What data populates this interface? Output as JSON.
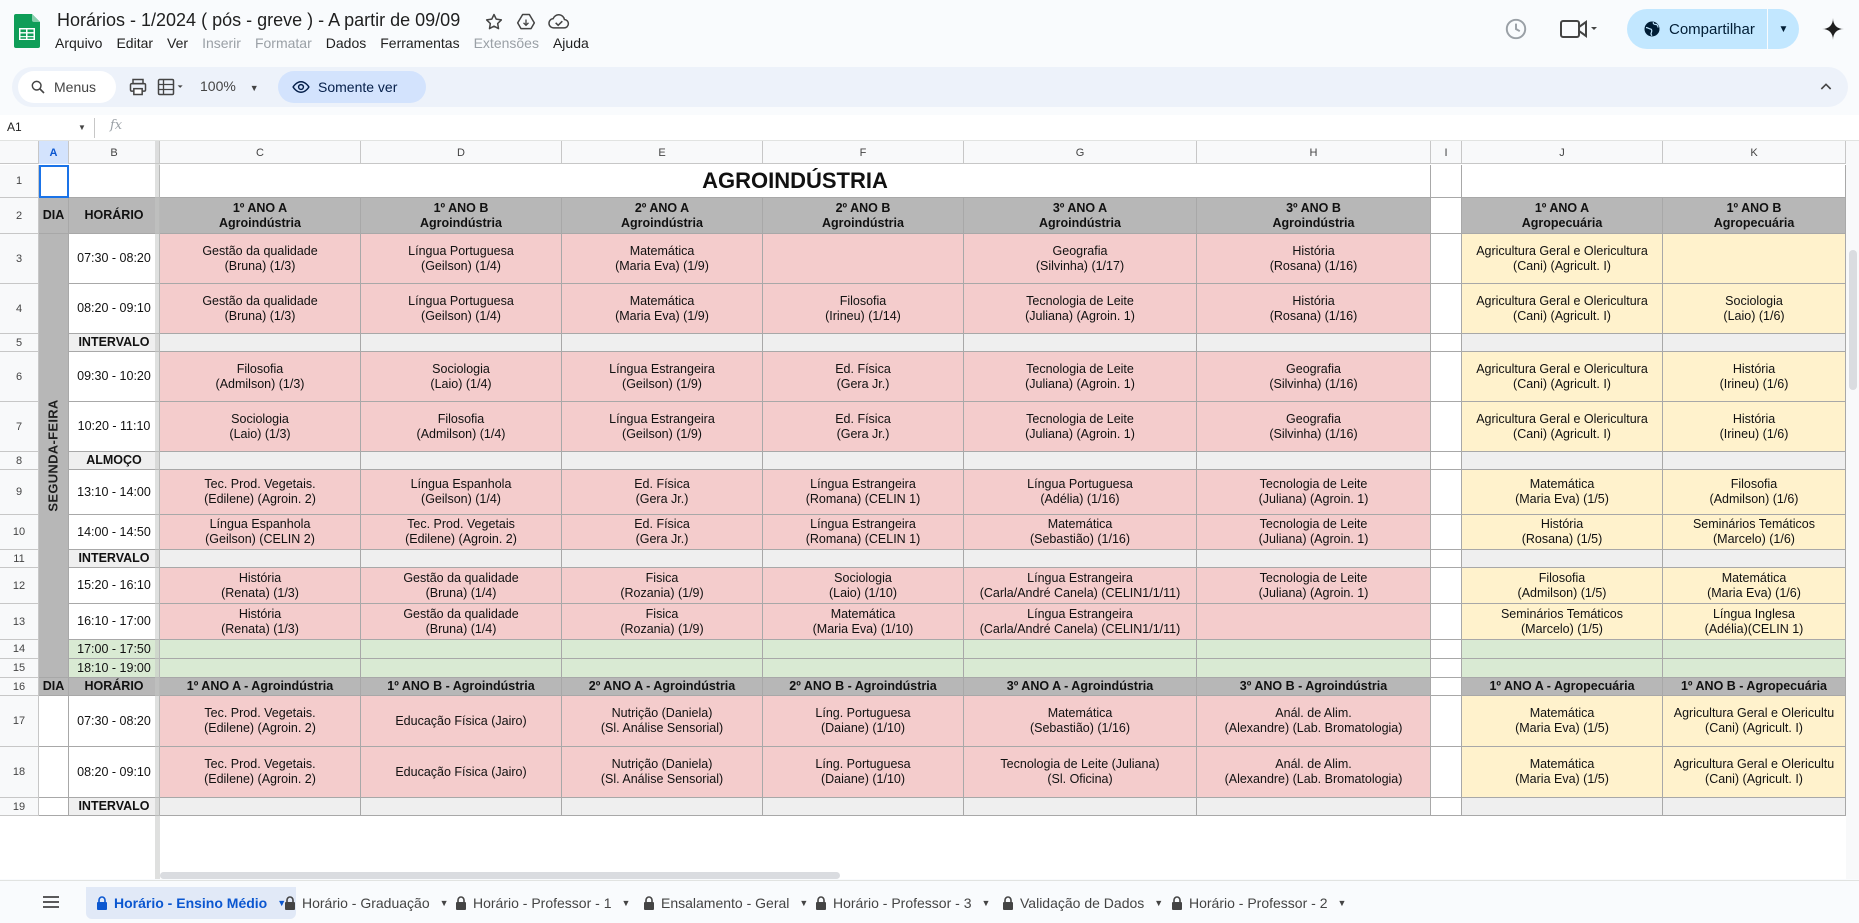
{
  "header": {
    "title": "Horários - 1/2024 ( pós - greve ) - A partir de 09/09",
    "menus": [
      {
        "label": "Arquivo",
        "disabled": false
      },
      {
        "label": "Editar",
        "disabled": false
      },
      {
        "label": "Ver",
        "disabled": false
      },
      {
        "label": "Inserir",
        "disabled": true
      },
      {
        "label": "Formatar",
        "disabled": true
      },
      {
        "label": "Dados",
        "disabled": false
      },
      {
        "label": "Ferramentas",
        "disabled": false
      },
      {
        "label": "Extensões",
        "disabled": true
      },
      {
        "label": "Ajuda",
        "disabled": false
      }
    ],
    "share_label": "Compartilhar"
  },
  "toolbar": {
    "search_placeholder": "Menus",
    "zoom": "100%",
    "view_only_label": "Somente ver"
  },
  "formula_bar": {
    "cell_ref": "A1",
    "fx": "fx"
  },
  "columns": [
    "A",
    "B",
    "C",
    "D",
    "E",
    "F",
    "G",
    "H",
    "I",
    "J",
    "K"
  ],
  "sheet": {
    "title": "AGROINDÚSTRIA",
    "header_row": {
      "dia": "DIA",
      "horario": "HORÁRIO",
      "classes": [
        [
          "1º ANO A",
          "Agroindústria"
        ],
        [
          "1º ANO B",
          "Agroindústria"
        ],
        [
          "2º ANO A",
          "Agroindústria"
        ],
        [
          "2º ANO B",
          "Agroindústria"
        ],
        [
          "3º ANO A",
          "Agroindústria"
        ],
        [
          "3º ANO B",
          "Agroindústria"
        ],
        [
          "1º ANO A",
          "Agropecuária"
        ],
        [
          "1º ANO B",
          "Agropecuária"
        ]
      ]
    },
    "day": "SEGUNDA-FEIRA",
    "rows": [
      {
        "n": "3",
        "time": "07:30 - 08:20",
        "kind": "class",
        "cells": [
          [
            "Gestão da qualidade",
            "(Bruna) (1/3)"
          ],
          [
            "Língua Portuguesa",
            "(Geilson) (1/4)"
          ],
          [
            "Matemática",
            "(Maria Eva) (1/9)"
          ],
          [],
          [
            "Geografia",
            "(Silvinha) (1/17)"
          ],
          [
            "História",
            "(Rosana) (1/16)"
          ],
          [
            "Agricultura Geral e Olericultura",
            "(Cani) (Agricult. I)"
          ],
          []
        ]
      },
      {
        "n": "4",
        "time": "08:20 - 09:10",
        "kind": "class",
        "cells": [
          [
            "Gestão da qualidade",
            "(Bruna) (1/3)"
          ],
          [
            "Língua Portuguesa",
            "(Geilson) (1/4)"
          ],
          [
            "Matemática",
            "(Maria Eva) (1/9)"
          ],
          [
            "Filosofia",
            "(Irineu) (1/14)"
          ],
          [
            "Tecnologia de Leite",
            "(Juliana) (Agroin. 1)"
          ],
          [
            "História",
            "(Rosana) (1/16)"
          ],
          [
            "Agricultura Geral e Olericultura",
            "(Cani) (Agricult. I)"
          ],
          [
            "Sociologia",
            "(Laio) (1/6)"
          ]
        ]
      },
      {
        "n": "5",
        "time": "INTERVALO",
        "kind": "break"
      },
      {
        "n": "6",
        "time": "09:30 - 10:20",
        "kind": "class",
        "cells": [
          [
            "Filosofia",
            "(Admilson) (1/3)"
          ],
          [
            "Sociologia",
            "(Laio) (1/4)"
          ],
          [
            "Língua Estrangeira",
            "(Geilson) (1/9)"
          ],
          [
            "Ed. Física",
            "(Gera Jr.)"
          ],
          [
            "Tecnologia de Leite",
            "(Juliana) (Agroin. 1)"
          ],
          [
            "Geografia",
            "(Silvinha) (1/16)"
          ],
          [
            "Agricultura Geral e Olericultura",
            "(Cani) (Agricult. I)"
          ],
          [
            "História",
            "(Irineu) (1/6)"
          ]
        ]
      },
      {
        "n": "7",
        "time": "10:20 - 11:10",
        "kind": "class",
        "cells": [
          [
            "Sociologia",
            "(Laio) (1/3)"
          ],
          [
            "Filosofia",
            "(Admilson) (1/4)"
          ],
          [
            "Língua Estrangeira",
            "(Geilson) (1/9)"
          ],
          [
            "Ed. Física",
            "(Gera Jr.)"
          ],
          [
            "Tecnologia de Leite",
            "(Juliana) (Agroin. 1)"
          ],
          [
            "Geografia",
            "(Silvinha) (1/16)"
          ],
          [
            "Agricultura Geral e Olericultura",
            "(Cani) (Agricult. I)"
          ],
          [
            "História",
            "(Irineu) (1/6)"
          ]
        ]
      },
      {
        "n": "8",
        "time": "ALMOÇO",
        "kind": "break"
      },
      {
        "n": "9",
        "time": "13:10 - 14:00",
        "kind": "class",
        "cells": [
          [
            "Tec. Prod. Vegetais.",
            "(Edilene) (Agroin. 2)"
          ],
          [
            "Língua Espanhola",
            "(Geilson) (1/4)"
          ],
          [
            "Ed. Física",
            "(Gera Jr.)"
          ],
          [
            "Língua Estrangeira",
            "(Romana) (CELIN 1)"
          ],
          [
            "Língua Portuguesa",
            "(Adélia) (1/16)"
          ],
          [
            "Tecnologia de Leite",
            "(Juliana) (Agroin. 1)"
          ],
          [
            "Matemática",
            "(Maria Eva) (1/5)"
          ],
          [
            "Filosofia",
            "(Admilson) (1/6)"
          ]
        ]
      },
      {
        "n": "10",
        "time": "14:00 - 14:50",
        "kind": "class",
        "cells": [
          [
            "Língua Espanhola",
            "(Geilson) (CELIN 2)"
          ],
          [
            "Tec. Prod. Vegetais",
            "(Edilene) (Agroin. 2)"
          ],
          [
            "Ed. Física",
            "(Gera Jr.)"
          ],
          [
            "Língua Estrangeira",
            "(Romana) (CELIN 1)"
          ],
          [
            "Matemática",
            "(Sebastião) (1/16)"
          ],
          [
            "Tecnologia de Leite",
            "(Juliana) (Agroin. 1)"
          ],
          [
            "História",
            "(Rosana) (1/5)"
          ],
          [
            "Seminários Temáticos",
            "(Marcelo) (1/6)"
          ]
        ]
      },
      {
        "n": "11",
        "time": "INTERVALO",
        "kind": "break"
      },
      {
        "n": "12",
        "time": "15:20 - 16:10",
        "kind": "class",
        "cells": [
          [
            "História",
            "(Renata) (1/3)"
          ],
          [
            "Gestão da qualidade",
            "(Bruna) (1/4)"
          ],
          [
            "Fisica",
            "(Rozania) (1/9)"
          ],
          [
            "Sociologia",
            "(Laio) (1/10)"
          ],
          [
            "Língua Estrangeira",
            "(Carla/André Canela) (CELIN1/1/11)"
          ],
          [
            "Tecnologia de Leite",
            "(Juliana) (Agroin. 1)"
          ],
          [
            "Filosofia",
            "(Admilson) (1/5)"
          ],
          [
            "Matemática",
            "(Maria Eva) (1/6)"
          ]
        ]
      },
      {
        "n": "13",
        "time": "16:10 - 17:00",
        "kind": "class",
        "cells": [
          [
            "História",
            "(Renata) (1/3)"
          ],
          [
            "Gestão da qualidade",
            "(Bruna) (1/4)"
          ],
          [
            "Fisica",
            "(Rozania) (1/9)"
          ],
          [
            "Matemática",
            "(Maria Eva) (1/10)"
          ],
          [
            "Língua Estrangeira",
            "(Carla/André Canela) (CELIN1/1/11)"
          ],
          [],
          [
            "Seminários Temáticos",
            "(Marcelo) (1/5)"
          ],
          [
            "Língua Inglesa",
            "(Adélia)(CELIN 1)"
          ]
        ]
      },
      {
        "n": "14",
        "time": "17:00 - 17:50",
        "kind": "evening"
      },
      {
        "n": "15",
        "time": "18:10 - 19:00",
        "kind": "evening"
      }
    ],
    "header_row2": {
      "n": "16",
      "dia": "DIA",
      "horario": "HORÁRIO",
      "classes": [
        "1º ANO A - Agroindústria",
        "1º ANO B - Agroindústria",
        "2º ANO A - Agroindústria",
        "2º ANO B - Agroindústria",
        "3º ANO A - Agroindústria",
        "3º ANO B - Agroindústria",
        "1º ANO A - Agropecuária",
        "1º ANO B - Agropecuária"
      ]
    },
    "rows2": [
      {
        "n": "17",
        "time": "07:30 - 08:20",
        "kind": "class",
        "cells": [
          [
            "Tec. Prod. Vegetais.",
            "(Edilene) (Agroin. 2)"
          ],
          [
            "Educação Física (Jairo)"
          ],
          [
            "Nutrição (Daniela)",
            "(Sl. Análise Sensorial)"
          ],
          [
            "Líng. Portuguesa",
            "(Daiane) (1/10)"
          ],
          [
            "Matemática",
            "(Sebastião) (1/16)"
          ],
          [
            "Anál. de Alim.",
            "(Alexandre)  (Lab. Bromatologia)"
          ],
          [
            "Matemática",
            "(Maria Eva) (1/5)"
          ],
          [
            "Agricultura Geral e Olericultu",
            "(Cani) (Agricult. I)"
          ]
        ]
      },
      {
        "n": "18",
        "time": "08:20 - 09:10",
        "kind": "class",
        "cells": [
          [
            "Tec. Prod. Vegetais.",
            "(Edilene) (Agroin. 2)"
          ],
          [
            "Educação Física (Jairo)"
          ],
          [
            "Nutrição (Daniela)",
            "(Sl. Análise Sensorial)"
          ],
          [
            "Líng. Portuguesa",
            "(Daiane) (1/10)"
          ],
          [
            "Tecnologia de Leite (Juliana)",
            "(Sl. Oficina)"
          ],
          [
            "Anál. de Alim.",
            "(Alexandre)  (Lab. Bromatologia)"
          ],
          [
            "Matemática",
            "(Maria Eva) (1/5)"
          ],
          [
            "Agricultura Geral e Olericultu",
            "(Cani) (Agricult. I)"
          ]
        ]
      },
      {
        "n": "19",
        "time": "INTERVALO",
        "kind": "break"
      }
    ]
  },
  "tabs": [
    {
      "label": "Horário - Ensino Médio",
      "active": true
    },
    {
      "label": "Horário - Graduação",
      "active": false
    },
    {
      "label": "Horário - Professor - 1",
      "active": false
    },
    {
      "label": "Ensalamento - Geral",
      "active": false
    },
    {
      "label": "Horário - Professor - 3",
      "active": false
    },
    {
      "label": "Validação de Dados",
      "active": false
    },
    {
      "label": "Horário - Professor - 2",
      "active": false
    }
  ],
  "colors": {
    "class_pink": "#f4cccc",
    "class_yellow": "#fff2cc",
    "header_grey": "#b7b7b7",
    "break_grey": "#efefef",
    "evening_green": "#d9ead3",
    "share_blue": "#c2e7ff",
    "active_tab": "#0b57d0"
  }
}
